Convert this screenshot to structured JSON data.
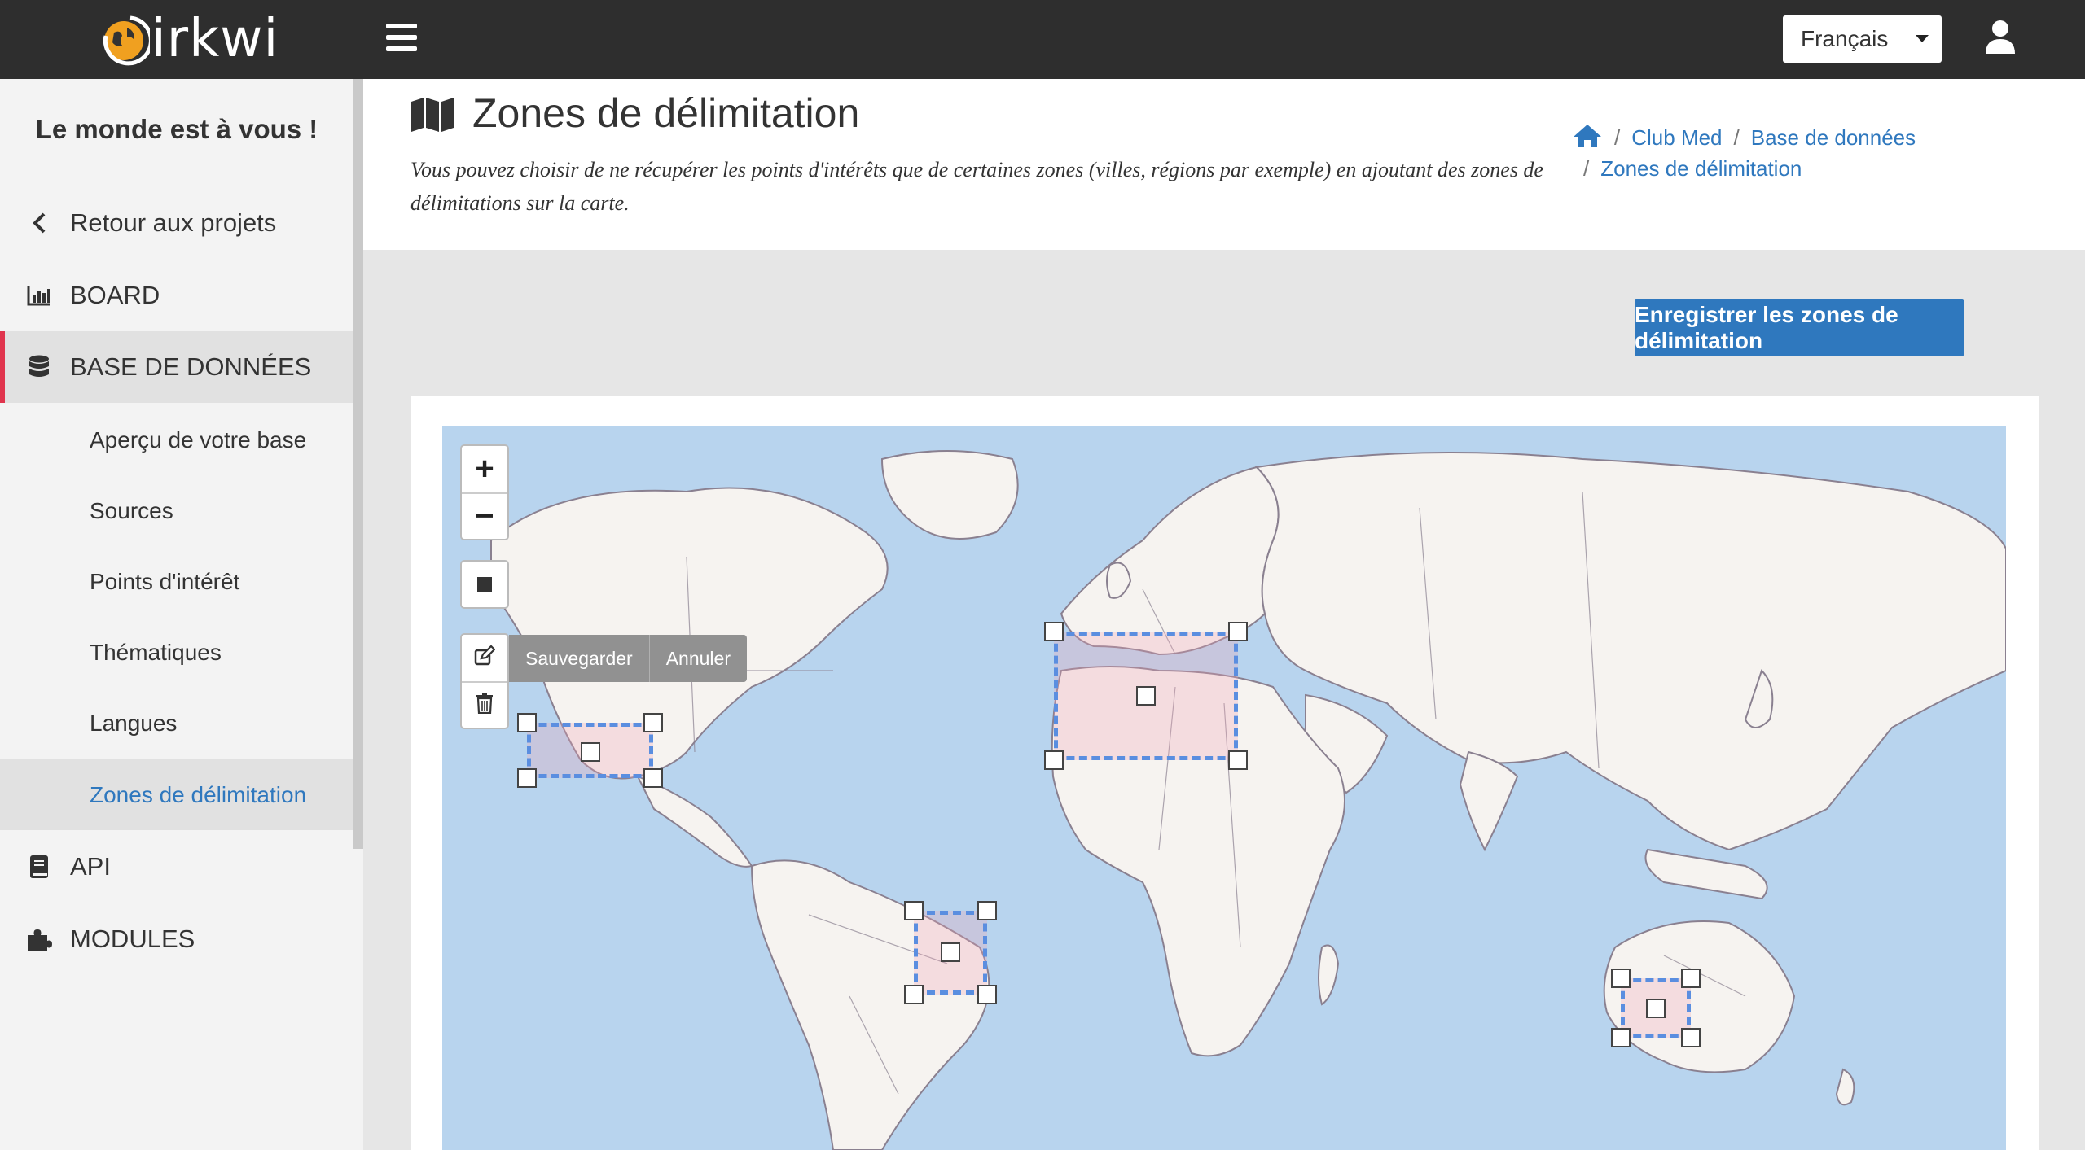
{
  "brand": {
    "name": "irkwi"
  },
  "topbar": {
    "language": "Français"
  },
  "sidebar": {
    "tagline": "Le monde est à vous !",
    "back_label": "Retour aux projets",
    "board_label": "BOARD",
    "database_label": "BASE DE DONNÉES",
    "sub_items": [
      "Aperçu de votre base",
      "Sources",
      "Points d'intérêt",
      "Thématiques",
      "Langues",
      "Zones de délimitation"
    ],
    "api_label": "API",
    "modules_label": "MODULES"
  },
  "header": {
    "title": "Zones de délimitation",
    "description": "Vous pouvez choisir de ne récupérer les points d'intérêts que de certaines zones (villes, régions par exemple) en ajoutant des zones de délimitations sur la carte.",
    "breadcrumb": [
      "Club Med",
      "Base de données",
      "Zones de délimitation"
    ]
  },
  "actions": {
    "save_zones": "Enregistrer les zones de délimitation"
  },
  "map": {
    "zoom_in": "+",
    "zoom_out": "−",
    "edit_save": "Sauvegarder",
    "edit_cancel": "Annuler",
    "zone_count": 4
  },
  "colors": {
    "topbar": "#2e2e2e",
    "accent": "#2f78be",
    "active_marker": "#e0344d",
    "zone_border": "#5a8ee0",
    "ocean": "#b8d4ee",
    "land": "#f6f3f0"
  },
  "icons": {
    "menu": "hamburger-icon",
    "user": "user-icon",
    "back": "chevron-left-icon",
    "board": "bar-chart-icon",
    "database": "database-icon",
    "api": "book-icon",
    "modules": "puzzle-icon",
    "title": "map-icon",
    "home": "home-icon",
    "draw": "square-icon",
    "edit": "edit-icon",
    "delete": "trash-icon"
  }
}
